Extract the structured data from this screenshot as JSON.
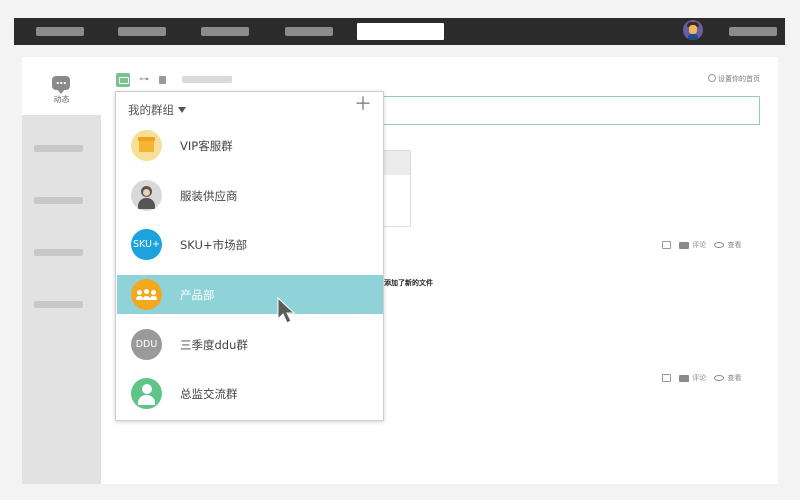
{
  "topbar": {
    "nav_count": 5,
    "active_index": 4
  },
  "sidebar": {
    "feed_label": "动态"
  },
  "toolbar": {
    "link_glyph": "⊶",
    "settings_label": "设置你的首页"
  },
  "feed": {
    "file_text": "添加了新的文件",
    "comment_label": "评论",
    "view_label": "查看"
  },
  "group_dropdown": {
    "title": "我的群组",
    "add_glyph": "＋",
    "items": [
      {
        "label": "VIP客服群",
        "avatar": "store-icon",
        "selected": false
      },
      {
        "label": "服装供应商",
        "avatar": "person-icon",
        "selected": false
      },
      {
        "label": "SKU+市场部",
        "avatar_text": "SKU+",
        "selected": false
      },
      {
        "label": "产品部",
        "avatar": "team-icon",
        "selected": true
      },
      {
        "label": "三季度ddu群",
        "avatar_text": "DDU",
        "selected": false
      },
      {
        "label": "总监交流群",
        "avatar": "user-icon",
        "selected": false
      }
    ]
  },
  "colors": {
    "topbar_bg": "#2b2b2b",
    "selected_row": "#8fd3d8",
    "accent_green": "#7cc28e"
  }
}
